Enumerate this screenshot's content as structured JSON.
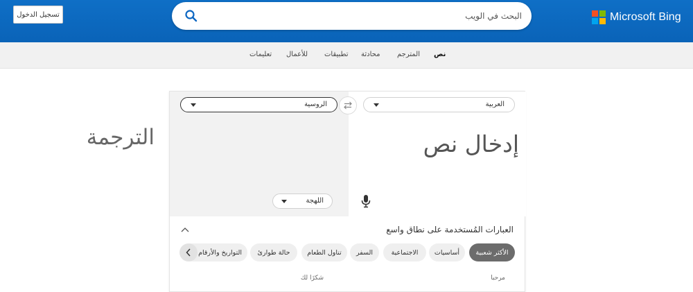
{
  "header": {
    "signin_label": "تسجيل الدخول",
    "search_placeholder": "البحث في الويب",
    "logo_text": "Microsoft Bing",
    "bg_color": "#0a63b8",
    "logo_colors": [
      "#f25022",
      "#7fba00",
      "#00a4ef",
      "#ffb900"
    ]
  },
  "nav": {
    "items": [
      {
        "label": "نص",
        "active": true
      },
      {
        "label": "المترجم"
      },
      {
        "label": "محادثة"
      },
      {
        "label": "تطبيقات"
      },
      {
        "label": "للأعمال"
      },
      {
        "label": "تعليمات"
      }
    ]
  },
  "translator": {
    "source_lang": "العربية",
    "target_lang": "الروسية",
    "source_placeholder": "إدخال نص",
    "target_placeholder": "الترجمة",
    "dialect_label": "اللهجة"
  },
  "phrases": {
    "title": "العبارات المُستخدمة على نطاق واسع",
    "categories": [
      "الأكثر شعبية",
      "أساسيات",
      "الاجتماعية",
      "السفر",
      "تناول الطعام",
      "حالة طوارئ",
      "التواريخ والأرقام"
    ],
    "col_source": "مرحبا",
    "col_target": "شكرًا لك"
  }
}
